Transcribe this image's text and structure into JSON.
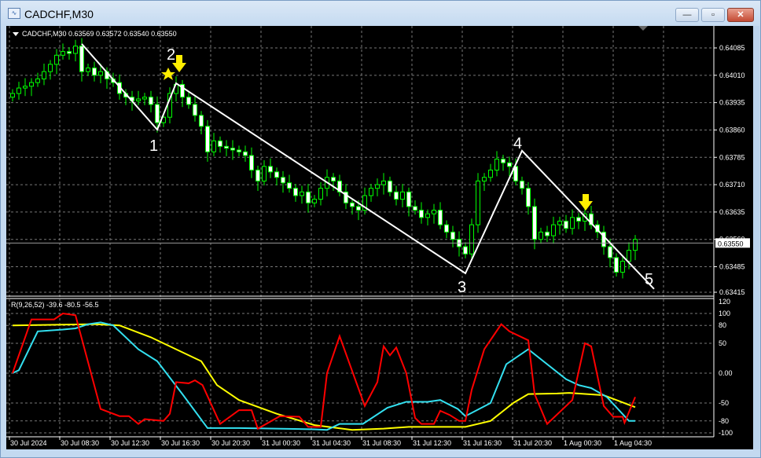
{
  "window": {
    "title": "CADCHF,M30",
    "minimize": "—",
    "maximize": "▫",
    "close": "✕"
  },
  "chart": {
    "header": "CADCHF,M30  0.63569 0.63572 0.63540 0.63550",
    "current_price": "0.63550",
    "price_labels": [
      "0.64085",
      "0.64010",
      "0.63935",
      "0.63860",
      "0.63785",
      "0.63710",
      "0.63635",
      "0.63560",
      "0.63485",
      "0.63415"
    ],
    "time_labels": [
      "30 Jul 2024",
      "30 Jul 08:30",
      "30 Jul 12:30",
      "30 Jul 16:30",
      "30 Jul 20:30",
      "31 Jul 00:30",
      "31 Jul 04:30",
      "31 Jul 08:30",
      "31 Jul 12:30",
      "31 Jul 16:30",
      "31 Jul 20:30",
      "1 Aug 00:30",
      "1 Aug 04:30"
    ],
    "wave_labels": [
      "1",
      "2",
      "3",
      "4",
      "5"
    ]
  },
  "indicator": {
    "header": "R(9,26,52) -39.6 -80.5 -56.5",
    "levels": [
      "120",
      "100",
      "80",
      "50",
      "0.00",
      "-50",
      "-80",
      "-100"
    ]
  },
  "colors": {
    "bg": "#000000",
    "candle": "#00ff00",
    "red": "#ff0000",
    "cyan": "#33e0f0",
    "yellow": "#ffff00",
    "arrow": "#ffee00"
  },
  "chart_data": {
    "type": "candlestick",
    "closes": [
      0.6396,
      0.63975,
      0.6398,
      0.6399,
      0.64,
      0.6402,
      0.6404,
      0.64065,
      0.64075,
      0.6407,
      0.6409,
      0.6402,
      0.6403,
      0.6401,
      0.6402,
      0.64,
      0.6399,
      0.6396,
      0.6395,
      0.6394,
      0.63945,
      0.6395,
      0.6393,
      0.6388,
      0.63895,
      0.6396,
      0.63985,
      0.6395,
      0.6393,
      0.639,
      0.6387,
      0.638,
      0.6383,
      0.63815,
      0.6381,
      0.63805,
      0.638,
      0.6379,
      0.6375,
      0.6372,
      0.6376,
      0.63745,
      0.6373,
      0.63715,
      0.637,
      0.6368,
      0.6369,
      0.6366,
      0.6367,
      0.637,
      0.6373,
      0.6372,
      0.6369,
      0.6366,
      0.6365,
      0.6364,
      0.6368,
      0.637,
      0.6371,
      0.6372,
      0.6369,
      0.6367,
      0.6369,
      0.6365,
      0.6364,
      0.6362,
      0.6363,
      0.6364,
      0.636,
      0.6358,
      0.6356,
      0.6354,
      0.6352,
      0.636,
      0.6372,
      0.6373,
      0.6375,
      0.6378,
      0.6377,
      0.6376,
      0.6372,
      0.637,
      0.6365,
      0.6356,
      0.6358,
      0.6357,
      0.636,
      0.6361,
      0.6359,
      0.6362,
      0.6361,
      0.6363,
      0.636,
      0.6358,
      0.6354,
      0.6351,
      0.6347,
      0.635,
      0.6353,
      0.6356
    ],
    "zigzag": [
      [
        11,
        0.64096
      ],
      [
        23,
        0.63861
      ],
      [
        26,
        0.63988
      ],
      [
        72,
        0.63467
      ],
      [
        81,
        0.63803
      ],
      [
        102,
        0.63424
      ]
    ],
    "red": [
      [
        0,
        0
      ],
      [
        3,
        90
      ],
      [
        6.6,
        90
      ],
      [
        8,
        100
      ],
      [
        10,
        97
      ],
      [
        14,
        -60
      ],
      [
        17,
        -72
      ],
      [
        18.5,
        -72
      ],
      [
        20,
        -85
      ],
      [
        21,
        -77
      ],
      [
        24,
        -80
      ],
      [
        25,
        -68
      ],
      [
        26,
        -15
      ],
      [
        28,
        -17
      ],
      [
        29,
        -12
      ],
      [
        30.2,
        -20
      ],
      [
        33,
        -85
      ],
      [
        36,
        -62
      ],
      [
        38,
        -62
      ],
      [
        39,
        -93
      ],
      [
        42.5,
        -72
      ],
      [
        45.6,
        -73
      ],
      [
        47,
        -90
      ],
      [
        49,
        -90
      ],
      [
        50,
        0
      ],
      [
        52,
        62
      ],
      [
        56,
        -55
      ],
      [
        58,
        -15
      ],
      [
        59,
        45
      ],
      [
        60,
        30
      ],
      [
        61,
        43
      ],
      [
        62.6,
        0
      ],
      [
        64,
        -75
      ],
      [
        65,
        -85
      ],
      [
        67,
        -85
      ],
      [
        68,
        -63
      ],
      [
        69.5,
        -70
      ],
      [
        71,
        -80
      ],
      [
        72,
        -80
      ],
      [
        73,
        -28
      ],
      [
        75,
        40
      ],
      [
        77.7,
        82
      ],
      [
        79,
        70
      ],
      [
        82,
        55
      ],
      [
        83,
        -35
      ],
      [
        85,
        -85
      ],
      [
        88,
        -55
      ],
      [
        89,
        -45
      ],
      [
        91,
        50
      ],
      [
        92,
        45
      ],
      [
        94,
        -55
      ],
      [
        95.5,
        -73
      ],
      [
        97,
        -73
      ],
      [
        97.3,
        -83
      ],
      [
        99,
        -40
      ]
    ],
    "cyan": [
      [
        0,
        0
      ],
      [
        1,
        5
      ],
      [
        4,
        70
      ],
      [
        8,
        73
      ],
      [
        10,
        75
      ],
      [
        12,
        82
      ],
      [
        14,
        85
      ],
      [
        16,
        80
      ],
      [
        20,
        40
      ],
      [
        23,
        20
      ],
      [
        27,
        -35
      ],
      [
        31,
        -92
      ],
      [
        36,
        -92
      ],
      [
        48,
        -94
      ],
      [
        50,
        -95
      ],
      [
        52,
        -85
      ],
      [
        55.7,
        -85
      ],
      [
        59.6,
        -58
      ],
      [
        62.6,
        -48
      ],
      [
        66,
        -48
      ],
      [
        68,
        -45
      ],
      [
        70.8,
        -60
      ],
      [
        72,
        -72
      ],
      [
        76,
        -50
      ],
      [
        78.5,
        15
      ],
      [
        82,
        40
      ],
      [
        88,
        -10
      ],
      [
        90,
        -20
      ],
      [
        92,
        -25
      ],
      [
        94.5,
        -40
      ],
      [
        98,
        -80
      ],
      [
        99,
        -80
      ]
    ],
    "yellow": [
      [
        0,
        80
      ],
      [
        13,
        82
      ],
      [
        17,
        80
      ],
      [
        22,
        60
      ],
      [
        26,
        40
      ],
      [
        30,
        20
      ],
      [
        32.5,
        -20
      ],
      [
        36,
        -45
      ],
      [
        42,
        -68
      ],
      [
        48,
        -87
      ],
      [
        54,
        -95
      ],
      [
        59,
        -93
      ],
      [
        63,
        -90
      ],
      [
        72,
        -90
      ],
      [
        76,
        -80
      ],
      [
        79.6,
        -50
      ],
      [
        82,
        -35
      ],
      [
        86.6,
        -34
      ],
      [
        88.5,
        -33
      ],
      [
        94,
        -37
      ],
      [
        99,
        -57
      ]
    ],
    "price_range": [
      0.63415,
      0.64085
    ],
    "indicator_range": [
      -100,
      120
    ]
  }
}
